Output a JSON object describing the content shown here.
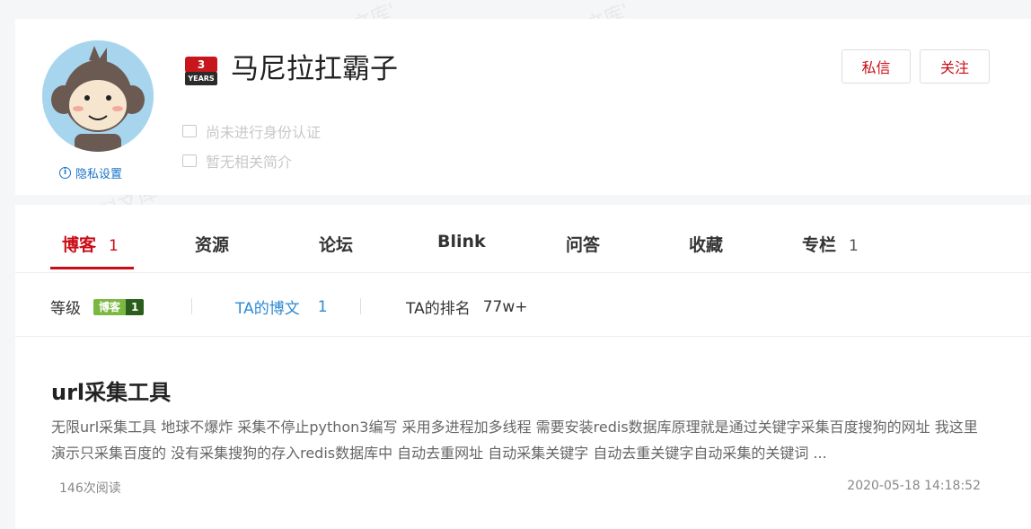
{
  "profile": {
    "username": "马尼拉扛霸子",
    "years_badge": {
      "number": "3",
      "label": "YEARS"
    },
    "privacy_label": "隐私设置",
    "verify_text": "尚未进行身份认证",
    "intro_text": "暂无相关简介",
    "message_label": "私信",
    "follow_label": "关注"
  },
  "tabs": [
    {
      "label": "博客",
      "count": "1",
      "active": true
    },
    {
      "label": "资源",
      "count": ""
    },
    {
      "label": "论坛",
      "count": ""
    },
    {
      "label": "Blink",
      "count": ""
    },
    {
      "label": "问答",
      "count": ""
    },
    {
      "label": "收藏",
      "count": ""
    },
    {
      "label": "专栏",
      "count": "1"
    }
  ],
  "stats": {
    "level_label": "等级",
    "level_badge_text": "博客",
    "level_badge_num": "1",
    "articles_label": "TA的博文",
    "articles_count": "1",
    "rank_label": "TA的排名",
    "rank_value": "77w+"
  },
  "article": {
    "title": "url采集工具",
    "summary": "无限url采集工具 地球不爆炸 采集不停止python3编写 采用多进程加多线程 需要安装redis数据库原理就是通过关键字采集百度搜狗的网址 我这里演示只采集百度的 没有采集搜狗的存入redis数据库中 自动去重网址 自动采集关键字 自动去重关键字自动采集的关键词 ...",
    "read_count": "146次阅读",
    "date": "2020-05-18 14:18:52"
  },
  "watermark_text": "'零组资料文库'",
  "colors": {
    "accent": "#ca0c16",
    "link": "#2e8ad3",
    "badge_green": "#7bb842"
  }
}
